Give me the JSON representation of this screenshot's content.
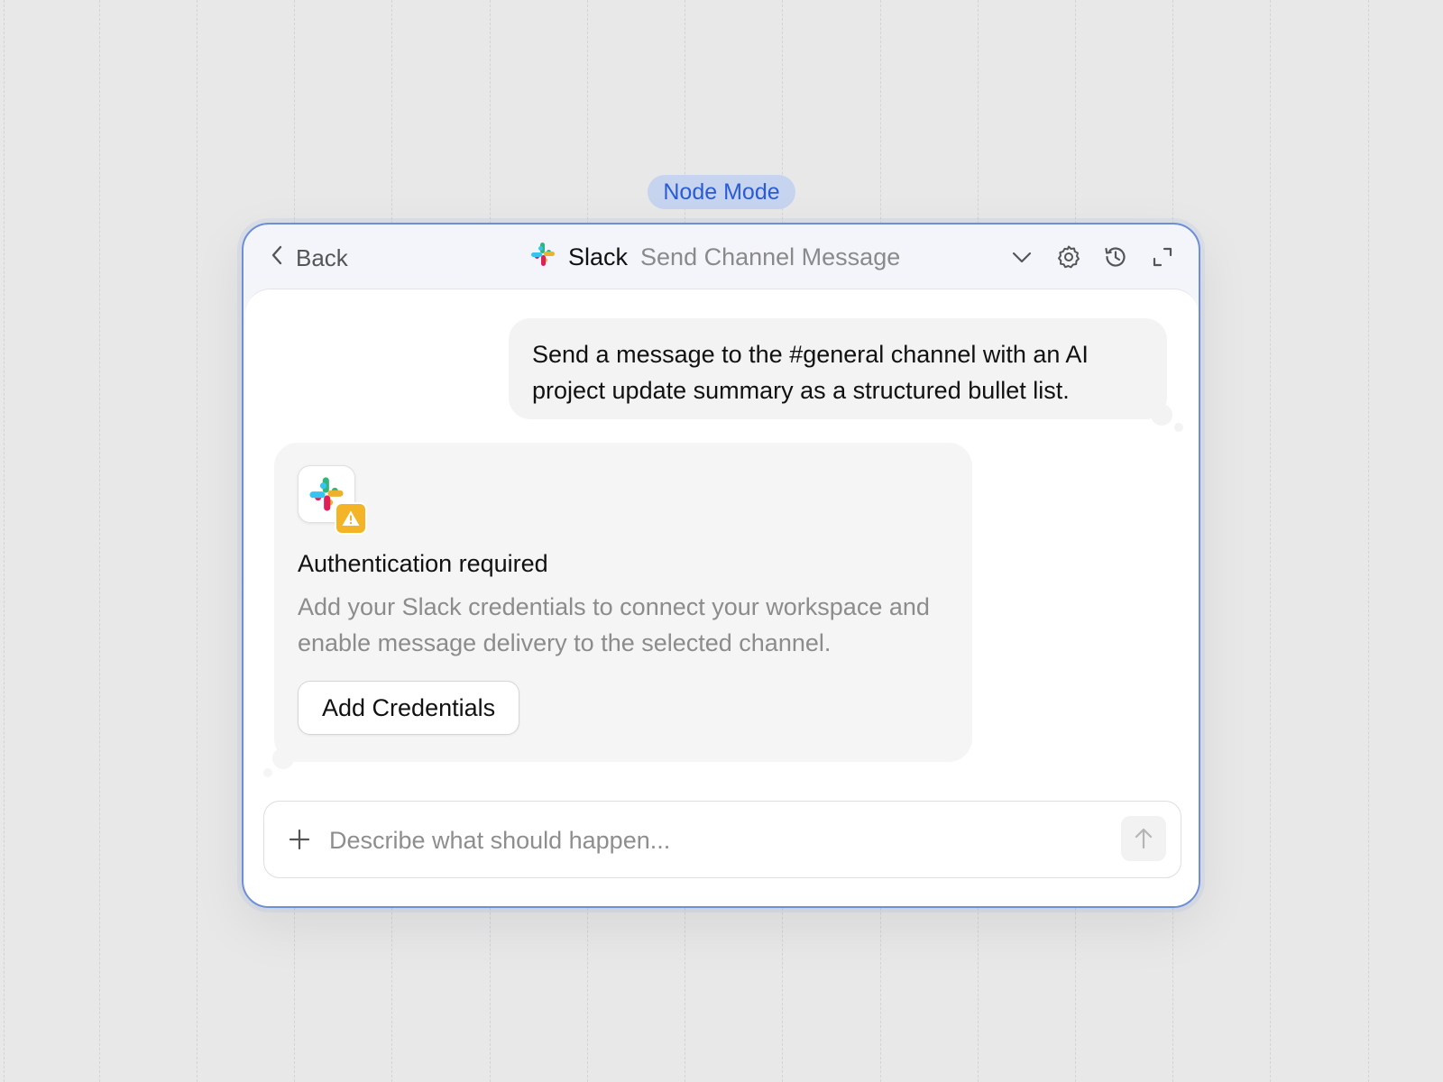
{
  "canvas": {
    "mode_label": "Node Mode"
  },
  "header": {
    "back_label": "Back",
    "app_name": "Slack",
    "action_name": "Send Channel Message",
    "icons": [
      "chevron-down-icon",
      "gear-icon",
      "history-icon",
      "expand-icon"
    ]
  },
  "messages": {
    "user": "Send a message to the #general channel with an AI project update summary as a structured bullet list.",
    "assistant": {
      "app_icon": "slack-logo",
      "status_icon": "warning-icon",
      "title": "Authentication required",
      "description": "Add your Slack credentials to connect your workspace and enable message delivery to the selected channel.",
      "button_label": "Add Credentials"
    }
  },
  "composer": {
    "placeholder": "Describe what should happen...",
    "value": ""
  },
  "colors": {
    "accent": "#2a5bd7",
    "panel_border": "#6e8fd8",
    "warning": "#f3b527",
    "slack": [
      "#36c5f0",
      "#2eb67d",
      "#ecb22e",
      "#e01e5a"
    ]
  }
}
